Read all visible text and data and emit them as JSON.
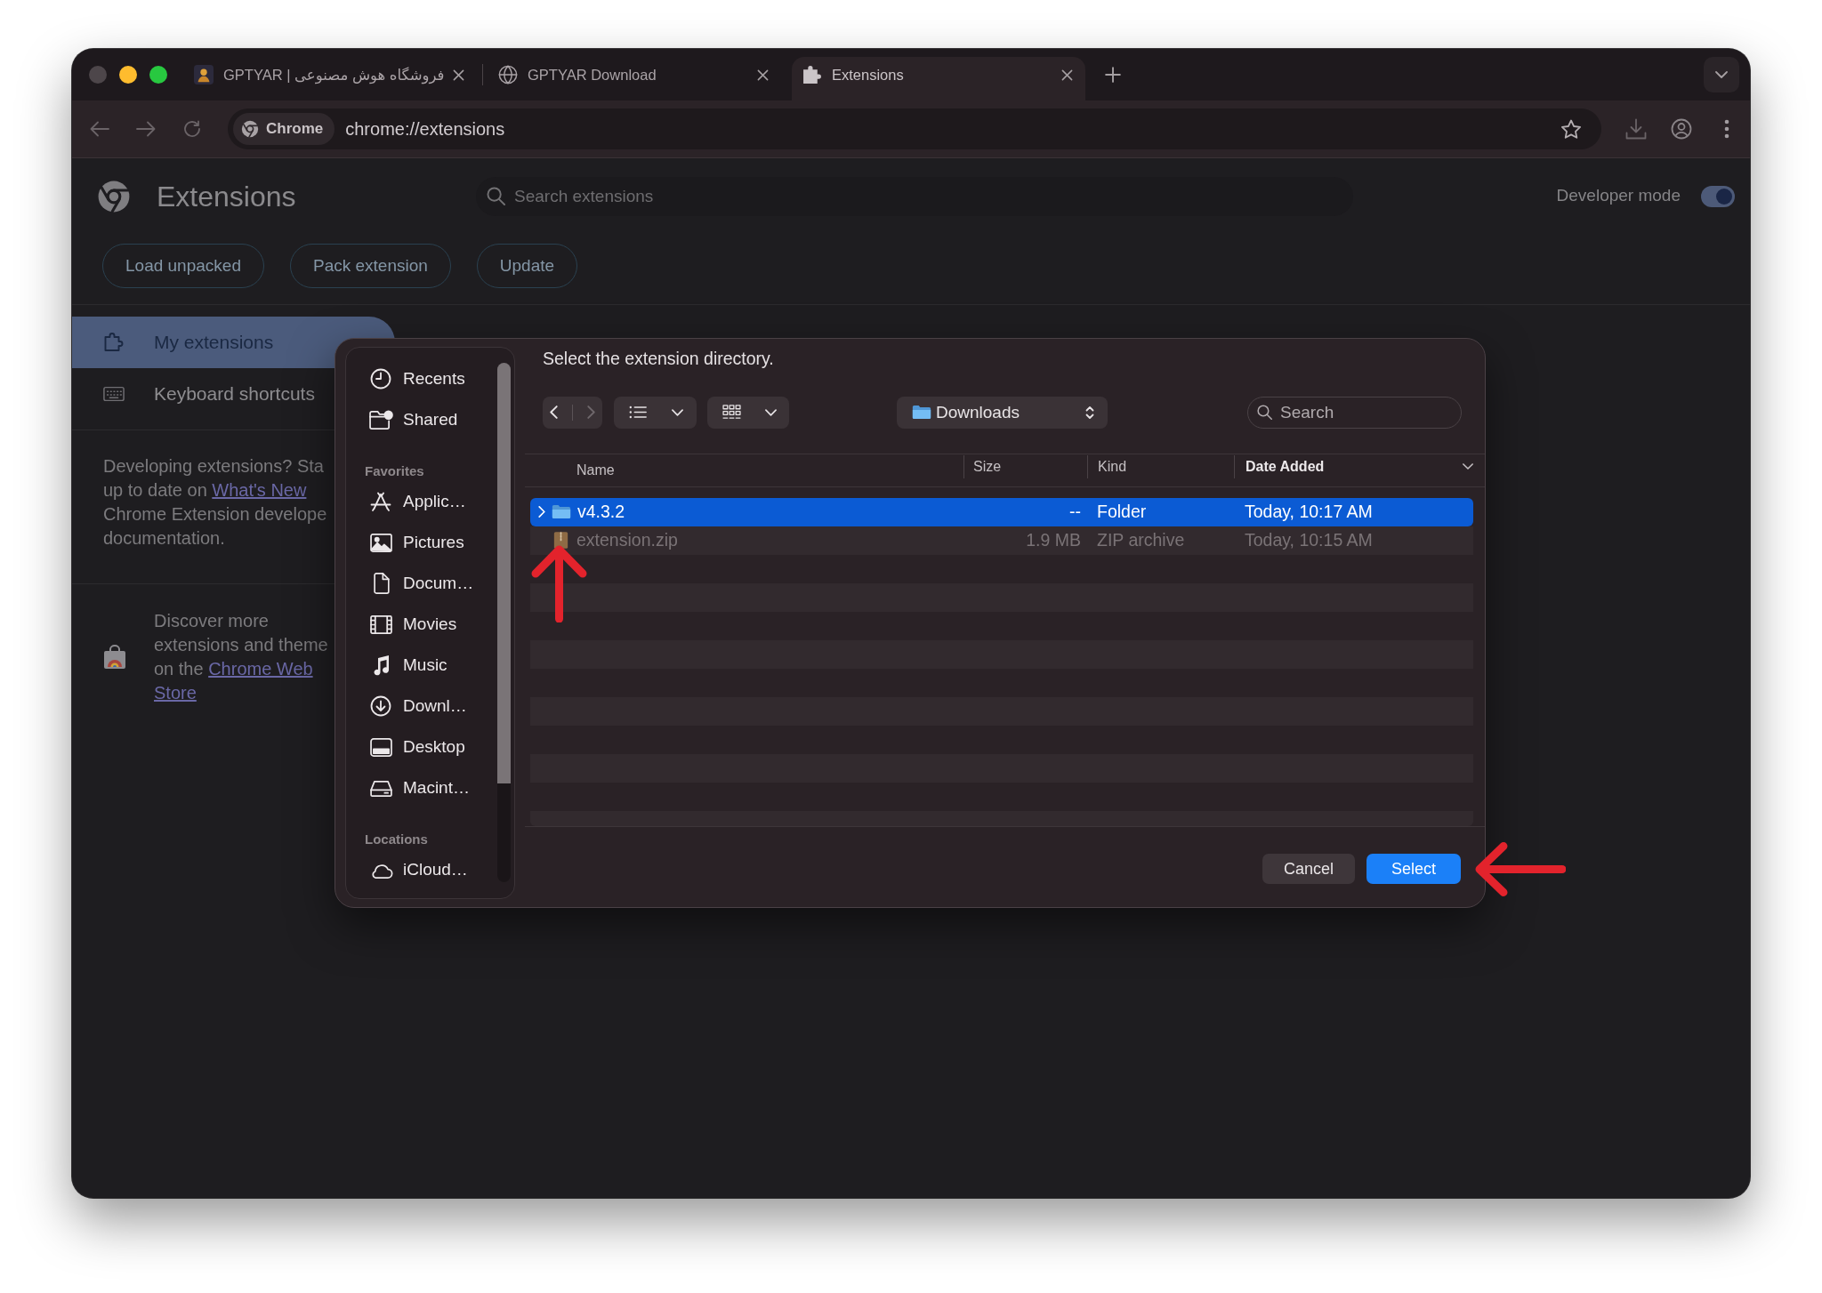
{
  "browser": {
    "tabs": [
      {
        "title": "GPTYAR | فروشگاه هوش مصنوعی",
        "selected": false
      },
      {
        "title": "GPTYAR Download",
        "selected": false
      },
      {
        "title": "Extensions",
        "selected": true
      }
    ],
    "address_bar": {
      "chip": "Chrome",
      "url": "chrome://extensions"
    }
  },
  "page": {
    "title": "Extensions",
    "search": {
      "placeholder": "Search extensions"
    },
    "developer_mode": {
      "label": "Developer mode",
      "on": true
    },
    "buttons": [
      "Load unpacked",
      "Pack extension",
      "Update"
    ],
    "sidebar": {
      "items": [
        {
          "label": "My extensions",
          "selected": true
        },
        {
          "label": "Keyboard shortcuts",
          "selected": false
        }
      ],
      "developer_note": [
        [
          {
            "kind": "text",
            "text": "Developing extensions? Sta"
          }
        ],
        [
          {
            "kind": "text",
            "text": "up to date on "
          },
          {
            "kind": "link",
            "text": "What's New"
          }
        ],
        [
          {
            "kind": "text",
            "text": "Chrome Extension develope"
          }
        ],
        [
          {
            "kind": "text",
            "text": "documentation."
          }
        ]
      ],
      "store_note": [
        [
          {
            "kind": "text",
            "text": "Discover more"
          }
        ],
        [
          {
            "kind": "text",
            "text": "extensions and theme"
          }
        ],
        [
          {
            "kind": "text",
            "text": "on the "
          },
          {
            "kind": "link",
            "text": "Chrome Web"
          }
        ],
        [
          {
            "kind": "link",
            "text": "Store"
          }
        ]
      ]
    }
  },
  "file_dialog": {
    "title": "Select the extension directory.",
    "sidebar": {
      "sections": [
        {
          "items": [
            "Recents",
            "Shared"
          ]
        },
        {
          "heading": "Favorites",
          "items": [
            "Applic…",
            "Pictures",
            "Docum…",
            "Movies",
            "Music",
            "Downl…",
            "Desktop",
            "Macint…"
          ]
        },
        {
          "heading": "Locations",
          "items": [
            "iCloud…"
          ]
        }
      ]
    },
    "location": "Downloads",
    "search": {
      "placeholder": "Search"
    },
    "columns": [
      {
        "label": "Name",
        "sorted": false
      },
      {
        "label": "Size",
        "sorted": false
      },
      {
        "label": "Kind",
        "sorted": false
      },
      {
        "label": "Date Added",
        "sorted": true
      }
    ],
    "rows": [
      {
        "kind": "folder",
        "cells": [
          "v4.3.2",
          "--",
          "Folder",
          "Today, 10:17 AM"
        ],
        "selected": true,
        "disabled": false
      },
      {
        "kind": "archive",
        "cells": [
          "extension.zip",
          "1.9 MB",
          "ZIP archive",
          "Today, 10:15 AM"
        ],
        "selected": false,
        "disabled": true
      }
    ],
    "buttons": [
      {
        "label": "Cancel",
        "primary": false
      },
      {
        "label": "Select",
        "primary": true
      }
    ]
  }
}
